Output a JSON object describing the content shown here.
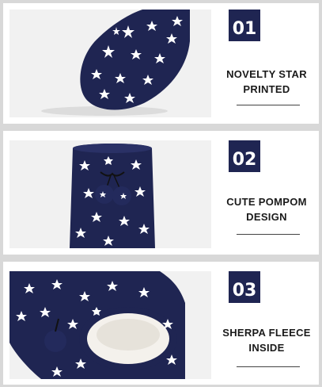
{
  "features": [
    {
      "number": "01",
      "line1": "NOVELTY STAR",
      "line2": "PRINTED"
    },
    {
      "number": "02",
      "line1": "CUTE POMPOM",
      "line2": "DESIGN"
    },
    {
      "number": "03",
      "line1": "SHERPA FLEECE",
      "line2": "INSIDE"
    }
  ],
  "colors": {
    "navy": "#1f2552",
    "sherpa": "#f4f1ec",
    "background": "#d8d8d8"
  }
}
